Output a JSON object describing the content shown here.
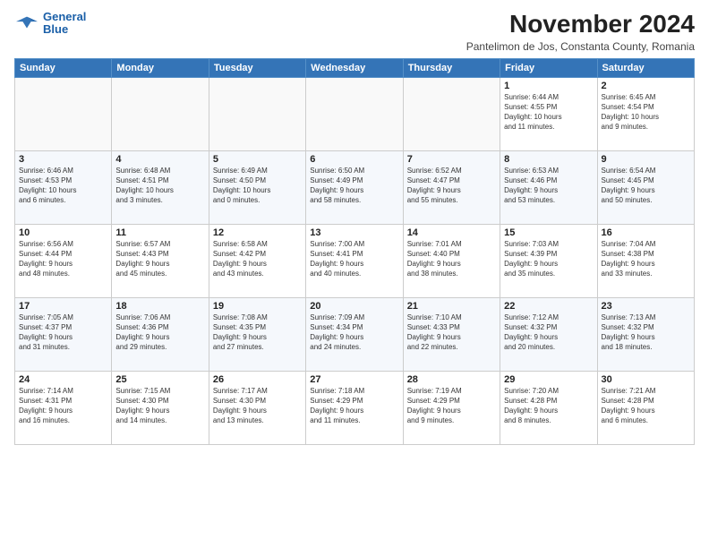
{
  "header": {
    "logo_line1": "General",
    "logo_line2": "Blue",
    "month_title": "November 2024",
    "subtitle": "Pantelimon de Jos, Constanta County, Romania"
  },
  "weekdays": [
    "Sunday",
    "Monday",
    "Tuesday",
    "Wednesday",
    "Thursday",
    "Friday",
    "Saturday"
  ],
  "weeks": [
    [
      {
        "day": "",
        "info": ""
      },
      {
        "day": "",
        "info": ""
      },
      {
        "day": "",
        "info": ""
      },
      {
        "day": "",
        "info": ""
      },
      {
        "day": "",
        "info": ""
      },
      {
        "day": "1",
        "info": "Sunrise: 6:44 AM\nSunset: 4:55 PM\nDaylight: 10 hours\nand 11 minutes."
      },
      {
        "day": "2",
        "info": "Sunrise: 6:45 AM\nSunset: 4:54 PM\nDaylight: 10 hours\nand 9 minutes."
      }
    ],
    [
      {
        "day": "3",
        "info": "Sunrise: 6:46 AM\nSunset: 4:53 PM\nDaylight: 10 hours\nand 6 minutes."
      },
      {
        "day": "4",
        "info": "Sunrise: 6:48 AM\nSunset: 4:51 PM\nDaylight: 10 hours\nand 3 minutes."
      },
      {
        "day": "5",
        "info": "Sunrise: 6:49 AM\nSunset: 4:50 PM\nDaylight: 10 hours\nand 0 minutes."
      },
      {
        "day": "6",
        "info": "Sunrise: 6:50 AM\nSunset: 4:49 PM\nDaylight: 9 hours\nand 58 minutes."
      },
      {
        "day": "7",
        "info": "Sunrise: 6:52 AM\nSunset: 4:47 PM\nDaylight: 9 hours\nand 55 minutes."
      },
      {
        "day": "8",
        "info": "Sunrise: 6:53 AM\nSunset: 4:46 PM\nDaylight: 9 hours\nand 53 minutes."
      },
      {
        "day": "9",
        "info": "Sunrise: 6:54 AM\nSunset: 4:45 PM\nDaylight: 9 hours\nand 50 minutes."
      }
    ],
    [
      {
        "day": "10",
        "info": "Sunrise: 6:56 AM\nSunset: 4:44 PM\nDaylight: 9 hours\nand 48 minutes."
      },
      {
        "day": "11",
        "info": "Sunrise: 6:57 AM\nSunset: 4:43 PM\nDaylight: 9 hours\nand 45 minutes."
      },
      {
        "day": "12",
        "info": "Sunrise: 6:58 AM\nSunset: 4:42 PM\nDaylight: 9 hours\nand 43 minutes."
      },
      {
        "day": "13",
        "info": "Sunrise: 7:00 AM\nSunset: 4:41 PM\nDaylight: 9 hours\nand 40 minutes."
      },
      {
        "day": "14",
        "info": "Sunrise: 7:01 AM\nSunset: 4:40 PM\nDaylight: 9 hours\nand 38 minutes."
      },
      {
        "day": "15",
        "info": "Sunrise: 7:03 AM\nSunset: 4:39 PM\nDaylight: 9 hours\nand 35 minutes."
      },
      {
        "day": "16",
        "info": "Sunrise: 7:04 AM\nSunset: 4:38 PM\nDaylight: 9 hours\nand 33 minutes."
      }
    ],
    [
      {
        "day": "17",
        "info": "Sunrise: 7:05 AM\nSunset: 4:37 PM\nDaylight: 9 hours\nand 31 minutes."
      },
      {
        "day": "18",
        "info": "Sunrise: 7:06 AM\nSunset: 4:36 PM\nDaylight: 9 hours\nand 29 minutes."
      },
      {
        "day": "19",
        "info": "Sunrise: 7:08 AM\nSunset: 4:35 PM\nDaylight: 9 hours\nand 27 minutes."
      },
      {
        "day": "20",
        "info": "Sunrise: 7:09 AM\nSunset: 4:34 PM\nDaylight: 9 hours\nand 24 minutes."
      },
      {
        "day": "21",
        "info": "Sunrise: 7:10 AM\nSunset: 4:33 PM\nDaylight: 9 hours\nand 22 minutes."
      },
      {
        "day": "22",
        "info": "Sunrise: 7:12 AM\nSunset: 4:32 PM\nDaylight: 9 hours\nand 20 minutes."
      },
      {
        "day": "23",
        "info": "Sunrise: 7:13 AM\nSunset: 4:32 PM\nDaylight: 9 hours\nand 18 minutes."
      }
    ],
    [
      {
        "day": "24",
        "info": "Sunrise: 7:14 AM\nSunset: 4:31 PM\nDaylight: 9 hours\nand 16 minutes."
      },
      {
        "day": "25",
        "info": "Sunrise: 7:15 AM\nSunset: 4:30 PM\nDaylight: 9 hours\nand 14 minutes."
      },
      {
        "day": "26",
        "info": "Sunrise: 7:17 AM\nSunset: 4:30 PM\nDaylight: 9 hours\nand 13 minutes."
      },
      {
        "day": "27",
        "info": "Sunrise: 7:18 AM\nSunset: 4:29 PM\nDaylight: 9 hours\nand 11 minutes."
      },
      {
        "day": "28",
        "info": "Sunrise: 7:19 AM\nSunset: 4:29 PM\nDaylight: 9 hours\nand 9 minutes."
      },
      {
        "day": "29",
        "info": "Sunrise: 7:20 AM\nSunset: 4:28 PM\nDaylight: 9 hours\nand 8 minutes."
      },
      {
        "day": "30",
        "info": "Sunrise: 7:21 AM\nSunset: 4:28 PM\nDaylight: 9 hours\nand 6 minutes."
      }
    ]
  ]
}
